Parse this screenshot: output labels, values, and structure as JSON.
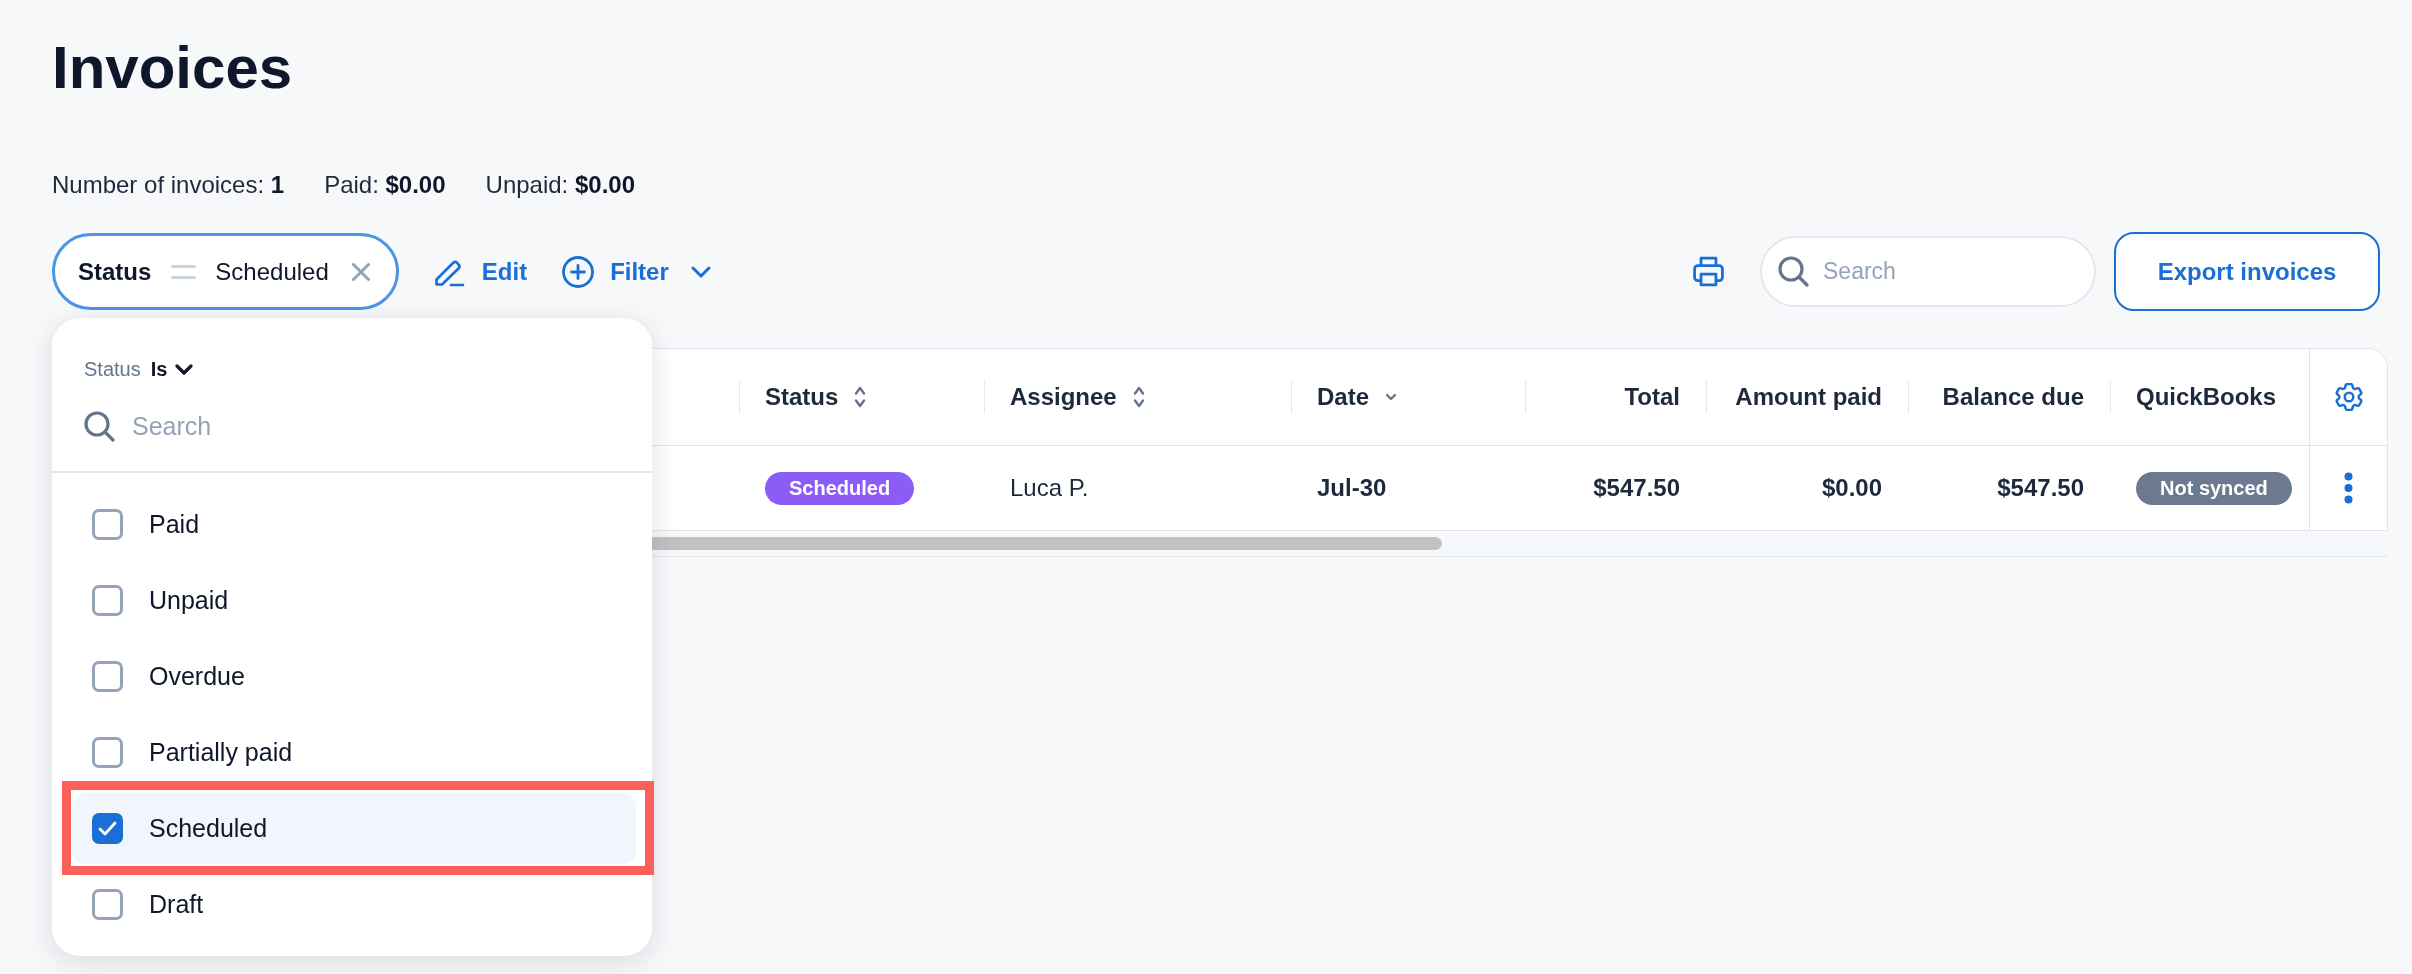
{
  "page": {
    "title": "Invoices"
  },
  "summary": [
    {
      "text": "Number of invoices: **1**"
    },
    {
      "text": "Paid: **$0.00**"
    },
    {
      "text": "Unpaid: **$0.00**"
    }
  ],
  "toolbar": {
    "filter_chip": {
      "field": "Status",
      "value": "Scheduled"
    },
    "actions": [
      {
        "kind": "edit",
        "label": "Edit"
      },
      {
        "kind": "filter",
        "label": "Filter"
      }
    ],
    "search": {
      "placeholder": "Search"
    },
    "export_button": {
      "label": "Export invoices"
    }
  },
  "filter_dropdown": {
    "field": "Status",
    "operator": "Is",
    "search": {
      "placeholder": "Search"
    },
    "options": [
      {
        "label": "Paid",
        "checked": false,
        "selected": false,
        "outlined": false
      },
      {
        "label": "Unpaid",
        "checked": false,
        "selected": false,
        "outlined": false
      },
      {
        "label": "Overdue",
        "checked": false,
        "selected": false,
        "outlined": false
      },
      {
        "label": "Partially paid",
        "checked": false,
        "selected": false,
        "outlined": false
      },
      {
        "label": "Scheduled",
        "checked": true,
        "selected": true,
        "outlined": true
      },
      {
        "label": "Draft",
        "checked": false,
        "selected": false,
        "outlined": false
      }
    ]
  },
  "table": {
    "columns": [
      {
        "label": "Status",
        "kind": "text",
        "sortable": true,
        "sorted": false
      },
      {
        "label": "Assignee",
        "kind": "text",
        "sortable": true,
        "sorted": false
      },
      {
        "label": "Date",
        "kind": "text",
        "sortable": true,
        "sorted": true
      },
      {
        "label": "Total",
        "kind": "amount",
        "sortable": false,
        "sorted": false
      },
      {
        "label": "Amount paid",
        "kind": "amount",
        "sortable": false,
        "sorted": false
      },
      {
        "label": "Balance due",
        "kind": "amount",
        "sortable": false,
        "sorted": false
      },
      {
        "label": "QuickBooks",
        "kind": "text",
        "sortable": false,
        "sorted": false
      }
    ],
    "rows": [
      {
        "cells": [
          {
            "kind": "badge",
            "text": "Scheduled",
            "color": "#8b5cf6"
          },
          {
            "kind": "text",
            "text": "Luca P."
          },
          {
            "kind": "strong",
            "text": "Jul-30"
          },
          {
            "kind": "amount",
            "text": "$547.50"
          },
          {
            "kind": "amount",
            "text": "$0.00"
          },
          {
            "kind": "amount",
            "text": "$547.50"
          },
          {
            "kind": "badge",
            "text": "Not synced",
            "color": "#6b7a90"
          }
        ]
      }
    ]
  }
}
